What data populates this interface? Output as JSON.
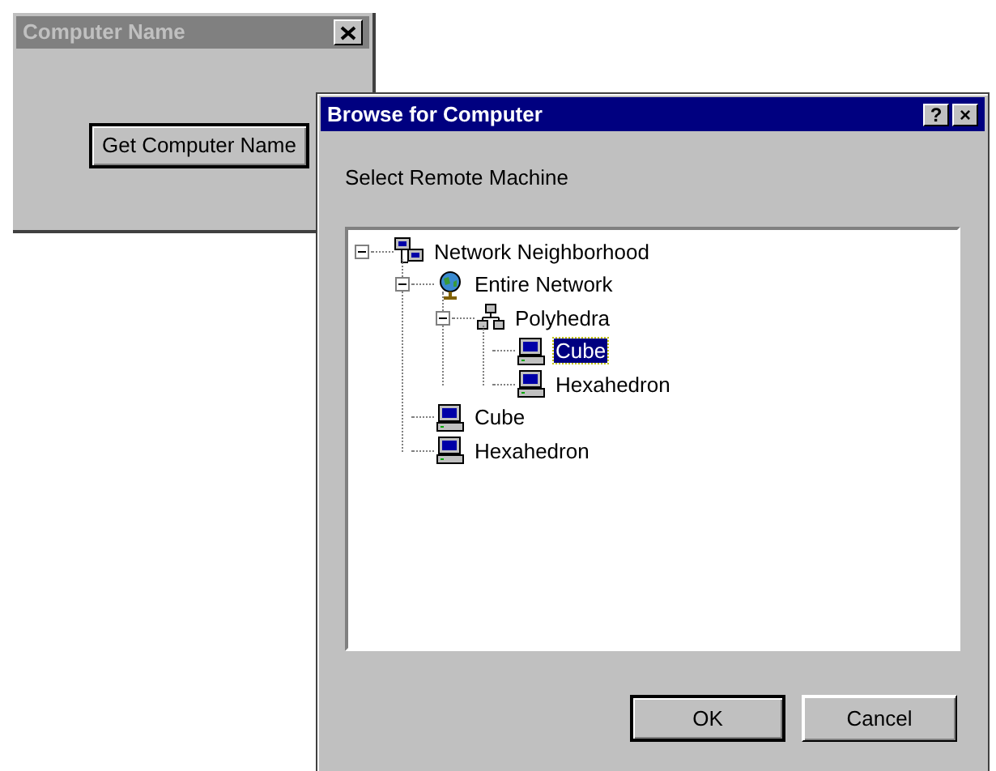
{
  "main_window": {
    "title": "Computer Name",
    "active": false,
    "button": "Get Computer Name"
  },
  "dialog": {
    "title": "Browse for Computer",
    "active": true,
    "title_buttons": [
      "?",
      "×"
    ],
    "prompt": "Select Remote Machine",
    "tree": [
      {
        "label": "Network Neighborhood",
        "kind": "network",
        "expanded": true,
        "selected": false,
        "children": [
          {
            "label": "Entire Network",
            "kind": "globe",
            "expanded": true,
            "selected": false,
            "children": [
              {
                "label": "Polyhedra",
                "kind": "workgroup",
                "expanded": true,
                "selected": false,
                "children": [
                  {
                    "label": "Cube",
                    "kind": "computer",
                    "selected": true
                  },
                  {
                    "label": "Hexahedron",
                    "kind": "computer",
                    "selected": false
                  }
                ]
              }
            ]
          },
          {
            "label": "Cube",
            "kind": "computer",
            "selected": false
          },
          {
            "label": "Hexahedron",
            "kind": "computer",
            "selected": false
          }
        ]
      }
    ],
    "buttons": [
      {
        "label": "OK",
        "default": true
      },
      {
        "label": "Cancel",
        "default": false
      }
    ]
  }
}
